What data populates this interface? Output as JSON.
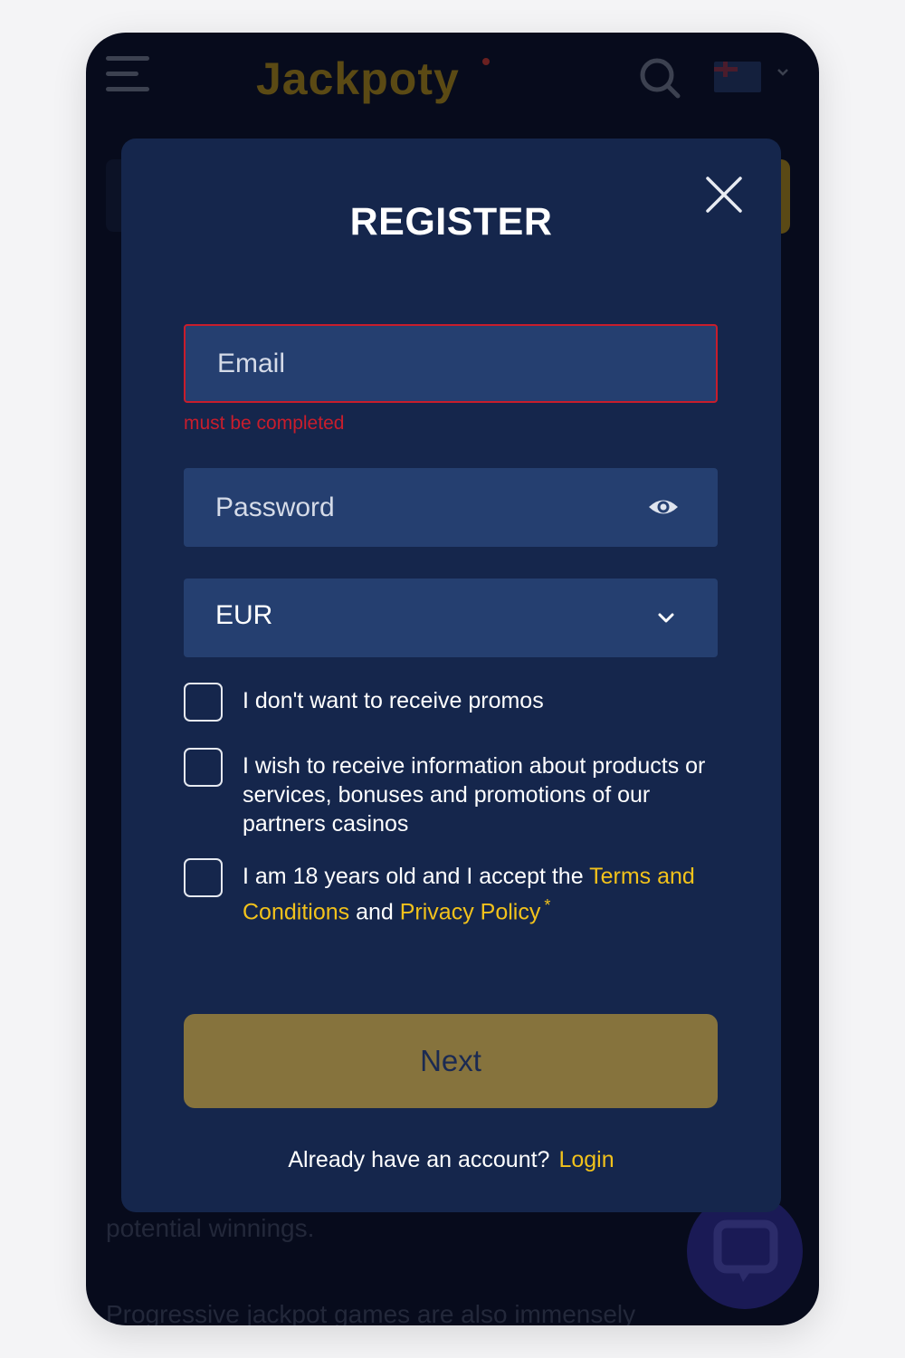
{
  "header": {
    "logo_text": "Jackpoty",
    "menu_icon": "hamburger-icon",
    "search_icon": "search-icon",
    "language_flag": "uk-flag-icon",
    "language_chevron": "chevron-down-icon"
  },
  "background": {
    "bottom_line": "potential winnings.",
    "bottom_line2": "Progressive jackpot games are also immensely"
  },
  "modal": {
    "title": "REGISTER",
    "close_icon": "close-icon",
    "email": {
      "placeholder": "Email",
      "error": "must be completed"
    },
    "password": {
      "placeholder": "Password",
      "toggle_icon": "eye-icon"
    },
    "currency": {
      "selected": "EUR",
      "icon": "chevron-down-icon"
    },
    "checkboxes": [
      {
        "label": "I don't want to receive promos",
        "checked": false
      },
      {
        "label": "I wish to receive information about products or services, bonuses and promotions of our partners casinos",
        "checked": false
      }
    ],
    "terms": {
      "prefix": "I am 18 years old and I accept the ",
      "terms_link": "Terms and Conditions",
      "middle": " and ",
      "privacy_link": "Privacy Policy",
      "required_mark": "*",
      "checked": false
    },
    "next_label": "Next",
    "footer": {
      "question": "Already have an account?",
      "login_link": "Login"
    }
  },
  "colors": {
    "accent": "#f2c21b",
    "error": "#c81d2c",
    "modal_bg": "#15264c",
    "field_bg": "#253f70",
    "button_bg": "#86733d"
  }
}
